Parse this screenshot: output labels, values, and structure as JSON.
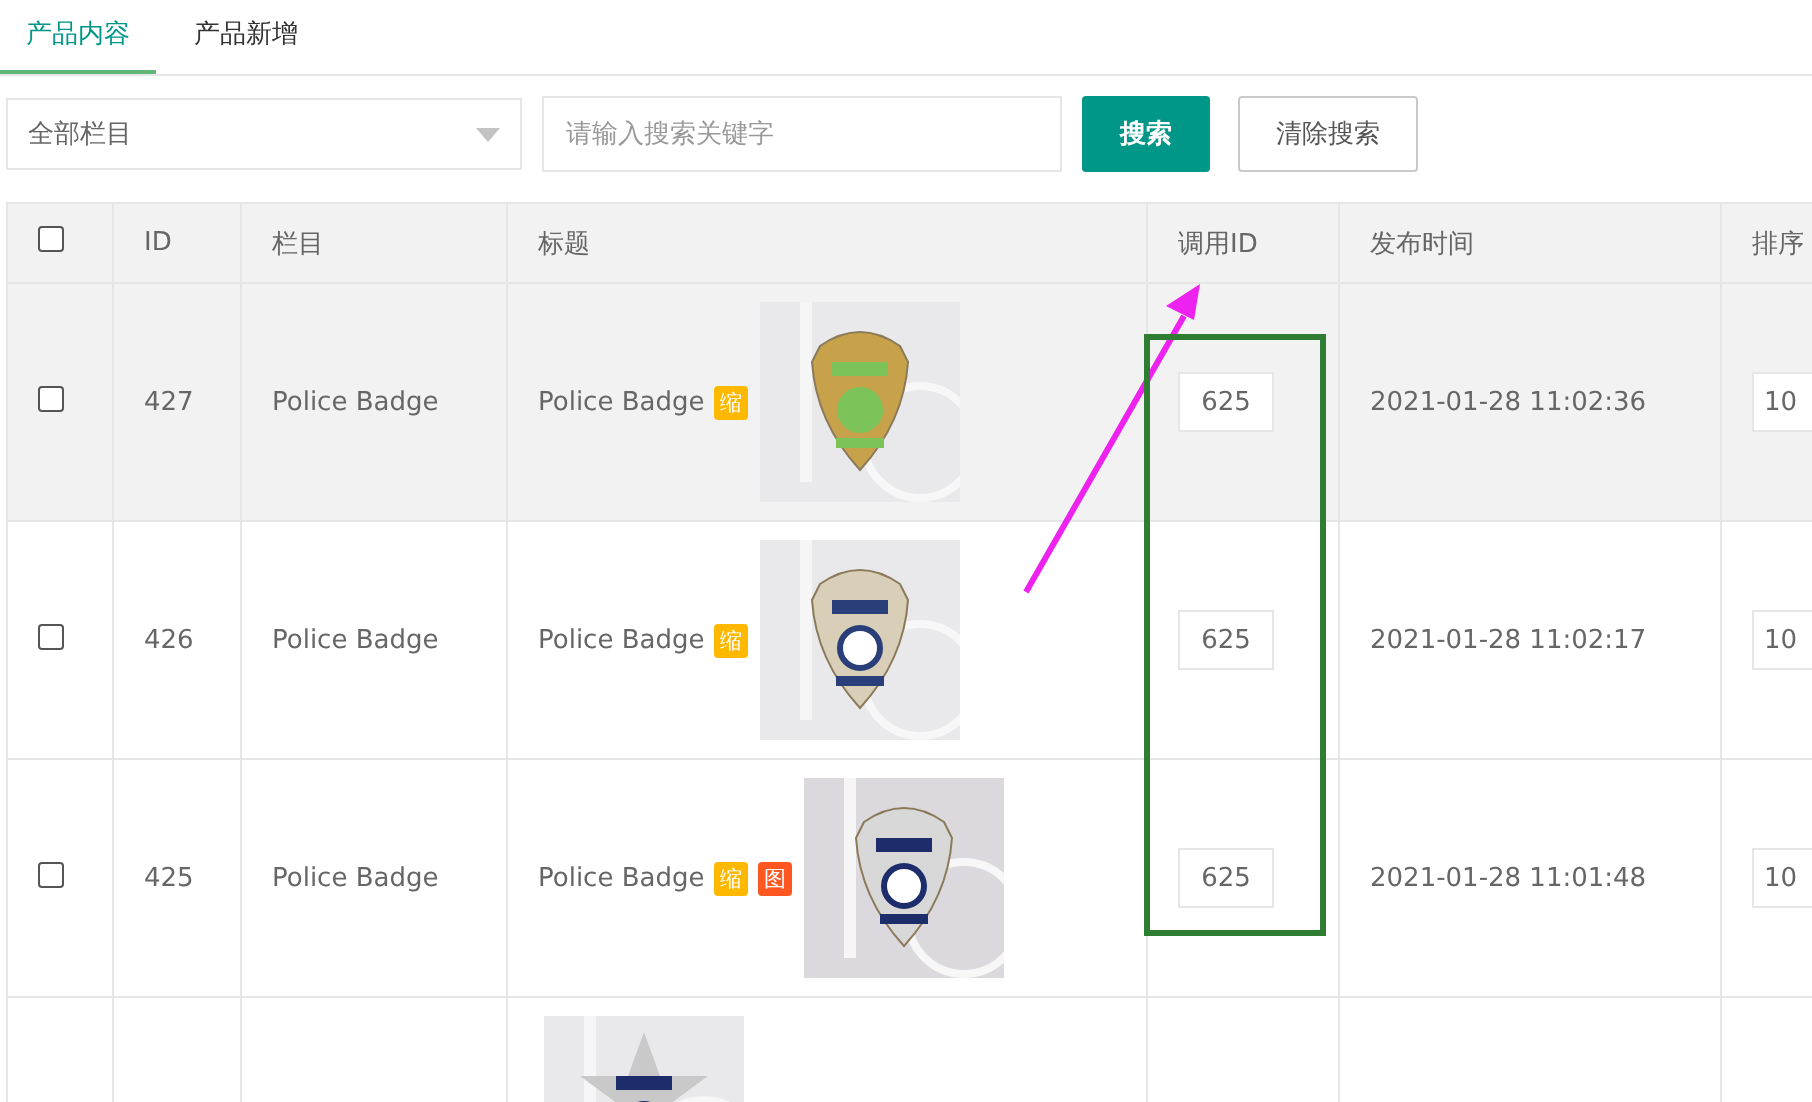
{
  "tabs": [
    {
      "label": "产品内容",
      "selected": true
    },
    {
      "label": "产品新增",
      "selected": false
    }
  ],
  "filters": {
    "category_select": "全部栏目",
    "search": {
      "placeholder": "请输入搜索关键字"
    },
    "search_button": "搜索",
    "clear_button": "清除搜索"
  },
  "table": {
    "header_checked": false,
    "columns": [
      "ID",
      "栏目",
      "标题",
      "调用ID",
      "发布时间",
      "排序"
    ],
    "rows": [
      {
        "checked": false,
        "hovered": true,
        "id": "427",
        "category": "Police Badge",
        "title": "Police Badge",
        "tags": [
          {
            "label": "缩",
            "color": "#ffb800"
          }
        ],
        "call_id": "625",
        "published": "2021-01-28 11:02:36",
        "sort": "10"
      },
      {
        "checked": false,
        "hovered": false,
        "id": "426",
        "category": "Police Badge",
        "title": "Police Badge",
        "tags": [
          {
            "label": "缩",
            "color": "#ffb800"
          }
        ],
        "call_id": "625",
        "published": "2021-01-28 11:02:17",
        "sort": "10"
      },
      {
        "checked": false,
        "hovered": false,
        "id": "425",
        "category": "Police Badge",
        "title": "Police Badge",
        "tags": [
          {
            "label": "缩",
            "color": "#ffb800"
          },
          {
            "label": "图",
            "color": "#ff5722"
          }
        ],
        "call_id": "625",
        "published": "2021-01-28 11:01:48",
        "sort": "10"
      },
      {
        "hovered": false
      }
    ]
  },
  "annotations": [
    {
      "kind": "arrow",
      "color": "#ee22ee"
    },
    {
      "kind": "frame",
      "color": "#2e7d32"
    }
  ]
}
